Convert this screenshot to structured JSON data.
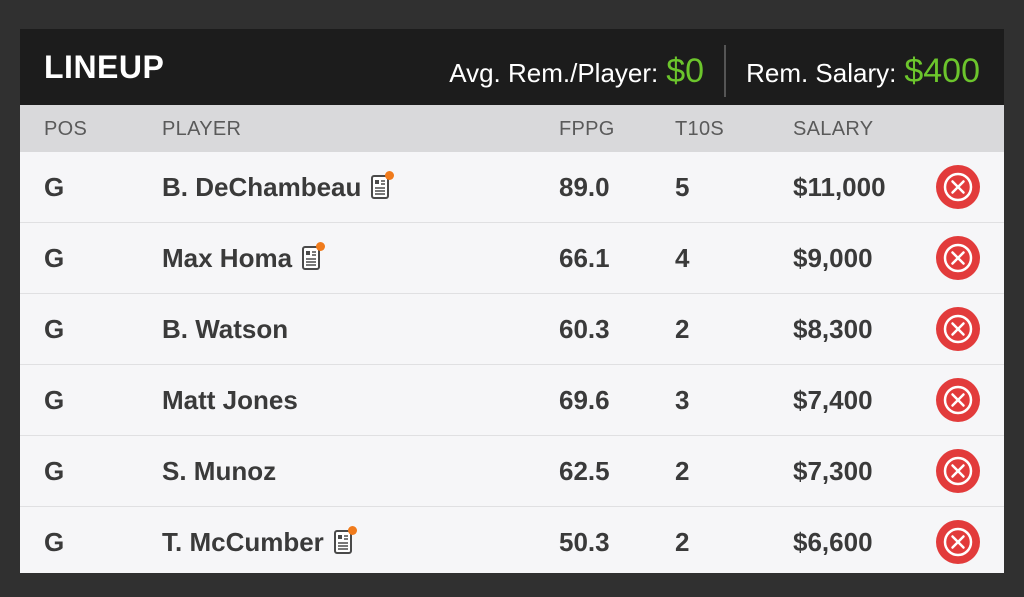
{
  "header": {
    "title": "LINEUP",
    "avg_rem_label": "Avg. Rem./Player:",
    "avg_rem_value": "$0",
    "rem_salary_label": "Rem. Salary:",
    "rem_salary_value": "$400"
  },
  "columns": {
    "pos": "POS",
    "player": "PLAYER",
    "fppg": "FPPG",
    "t10s": "T10S",
    "salary": "SALARY"
  },
  "rows": [
    {
      "pos": "G",
      "player": "B. DeChambeau",
      "news": true,
      "fppg": "89.0",
      "t10s": "5",
      "salary": "$11,000"
    },
    {
      "pos": "G",
      "player": "Max Homa",
      "news": true,
      "fppg": "66.1",
      "t10s": "4",
      "salary": "$9,000"
    },
    {
      "pos": "G",
      "player": "B. Watson",
      "news": false,
      "fppg": "60.3",
      "t10s": "2",
      "salary": "$8,300"
    },
    {
      "pos": "G",
      "player": "Matt Jones",
      "news": false,
      "fppg": "69.6",
      "t10s": "3",
      "salary": "$7,400"
    },
    {
      "pos": "G",
      "player": "S. Munoz",
      "news": false,
      "fppg": "62.5",
      "t10s": "2",
      "salary": "$7,300"
    },
    {
      "pos": "G",
      "player": "T. McCumber",
      "news": true,
      "fppg": "50.3",
      "t10s": "2",
      "salary": "$6,600"
    }
  ],
  "icons": {
    "news": "player-news-icon",
    "remove": "remove-player-icon"
  },
  "colors": {
    "accent_green": "#6cc52c",
    "remove_red": "#e23b3b",
    "news_dot": "#f07b1c",
    "topbar": "#1c1c1c"
  }
}
